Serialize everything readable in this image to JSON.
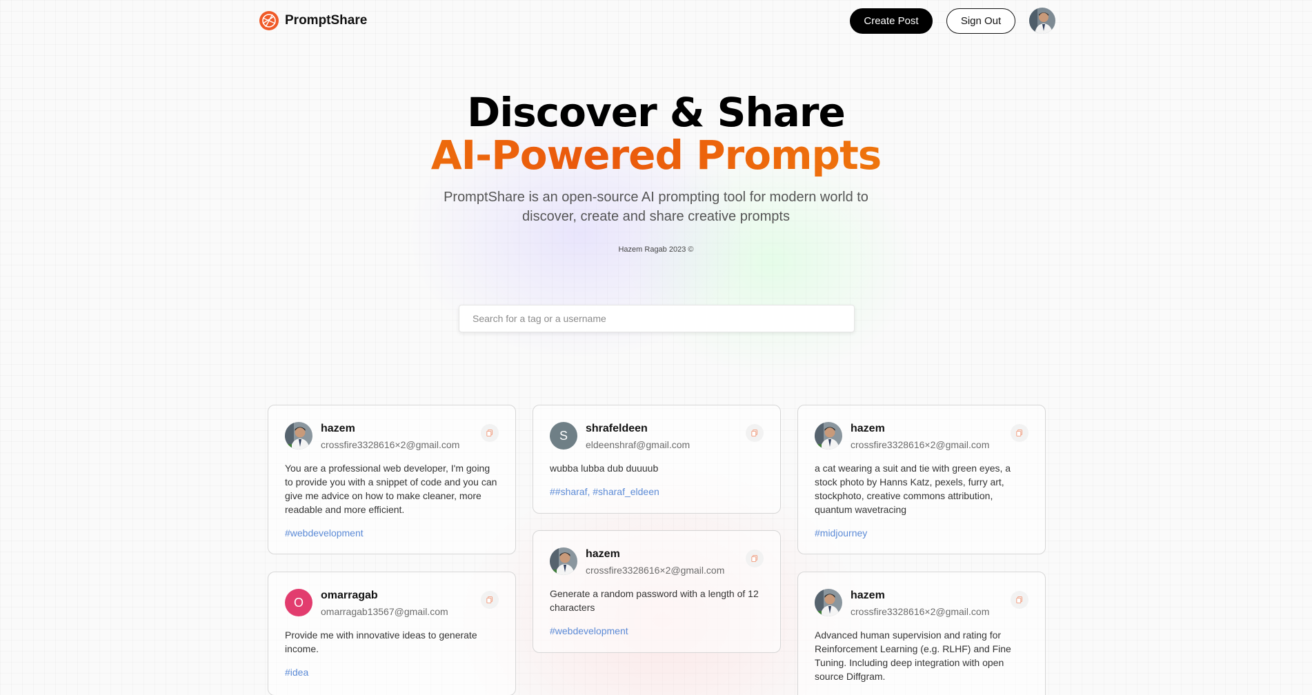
{
  "nav": {
    "brand": "PromptShare",
    "create_label": "Create Post",
    "signout_label": "Sign Out"
  },
  "hero": {
    "title_line1": "Discover & Share",
    "title_line2": "AI-Powered Prompts",
    "description": "PromptShare is an open-source AI prompting tool for modern world to discover, create and share creative prompts",
    "credit": "Hazem Ragab 2023 ©"
  },
  "search": {
    "placeholder": "Search for a tag or a username",
    "value": ""
  },
  "colors": {
    "accent_orange": "#ea580c",
    "tag_blue": "#5b8ad6"
  },
  "posts": [
    {
      "username": "hazem",
      "email": "crossfire3328616×2@gmail.com",
      "text": "You are a professional web developer, I'm going to provide you with a snippet of code and you can give me advice on how to make cleaner, more readable and more efficient.",
      "tags": "#webdevelopment",
      "avatar": "photo"
    },
    {
      "username": "omarragab",
      "email": "omarragab13567@gmail.com",
      "text": "Provide me with innovative ideas to generate income.",
      "tags": "#idea",
      "avatar_letter": "O",
      "avatar_color": "#e23c6e"
    },
    {
      "username": "shrafeldeen",
      "email": "eldeenshraf@gmail.com",
      "text": "wubba lubba dub duuuub",
      "tags": "##sharaf, #sharaf_eldeen",
      "avatar_letter": "S",
      "avatar_color": "#6f7f86"
    },
    {
      "username": "hazem",
      "email": "crossfire3328616×2@gmail.com",
      "text": "Generate a random password with a length of 12 characters",
      "tags": "#webdevelopment",
      "avatar": "photo"
    },
    {
      "username": "hazem",
      "email": "crossfire3328616×2@gmail.com",
      "text": "a cat wearing a suit and tie with green eyes, a stock photo by Hanns Katz, pexels, furry art, stockphoto, creative commons attribution, quantum wavetracing",
      "tags": "#midjourney",
      "avatar": "photo"
    },
    {
      "username": "hazem",
      "email": "crossfire3328616×2@gmail.com",
      "text": "Advanced human supervision and rating for Reinforcement Learning (e.g. RLHF) and Fine Tuning. Including deep integration with open source Diffgram.",
      "tags": "",
      "avatar": "photo"
    }
  ]
}
